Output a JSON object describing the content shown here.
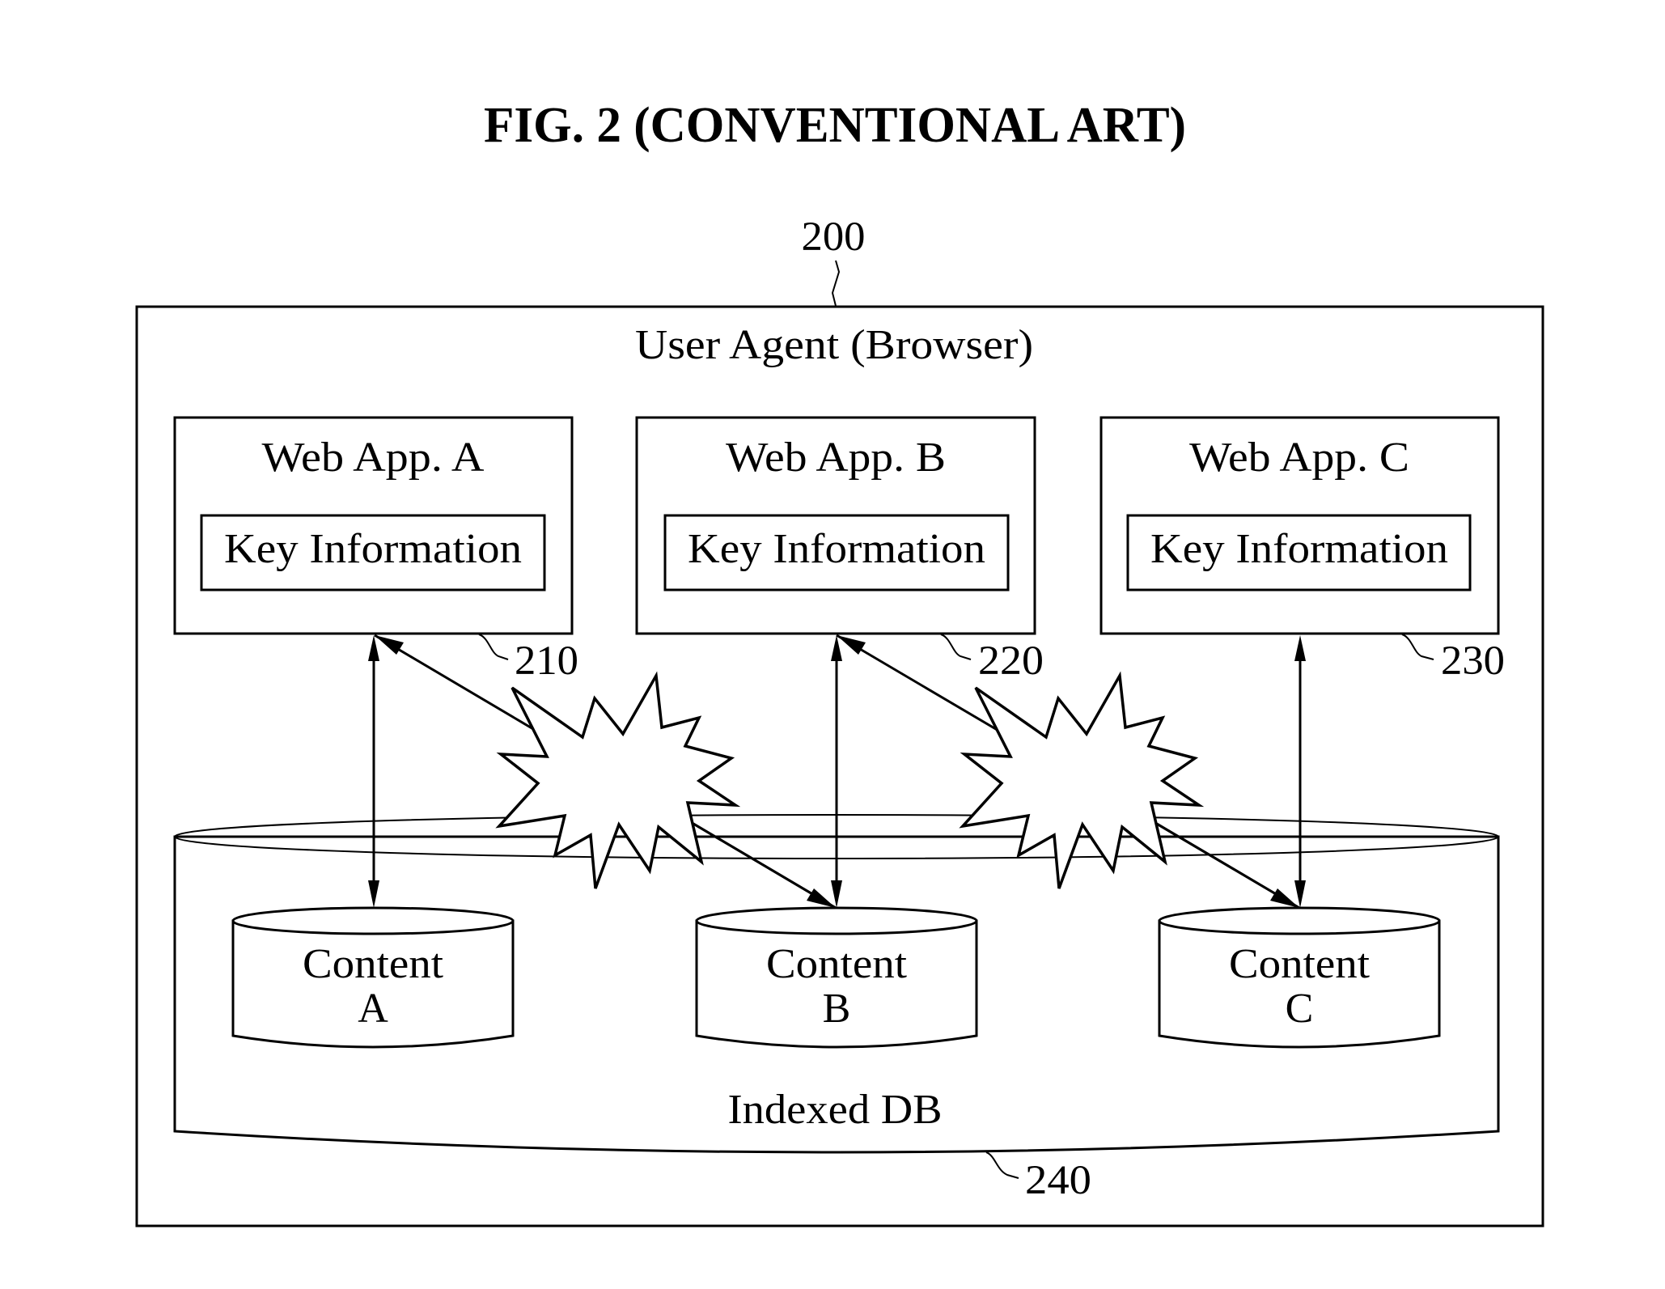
{
  "figure": {
    "title": "FIG. 2 (CONVENTIONAL ART)",
    "ref_number": "200",
    "container_label": "User Agent (Browser)"
  },
  "web_apps": [
    {
      "name": "Web App. A",
      "inner_label": "Key Information",
      "ref": "210"
    },
    {
      "name": "Web App. B",
      "inner_label": "Key Information",
      "ref": "220"
    },
    {
      "name": "Web App. C",
      "inner_label": "Key Information",
      "ref": "230"
    }
  ],
  "database": {
    "label": "Indexed DB",
    "ref": "240",
    "contents": [
      {
        "line1": "Content",
        "line2": "A"
      },
      {
        "line1": "Content",
        "line2": "B"
      },
      {
        "line1": "Content",
        "line2": "C"
      }
    ]
  },
  "connections": [
    {
      "from": "Web App. A",
      "to": "Content A",
      "type": "bidirectional"
    },
    {
      "from": "Web App. B",
      "to": "Content B",
      "type": "bidirectional"
    },
    {
      "from": "Web App. C",
      "to": "Content C",
      "type": "bidirectional"
    },
    {
      "from": "Web App. A",
      "to": "Content B",
      "type": "bidirectional",
      "blocked": true
    },
    {
      "from": "Web App. B",
      "to": "Content C",
      "type": "bidirectional",
      "blocked": true
    }
  ],
  "icons": {
    "blocked_marker": "explosion-burst-icon"
  }
}
